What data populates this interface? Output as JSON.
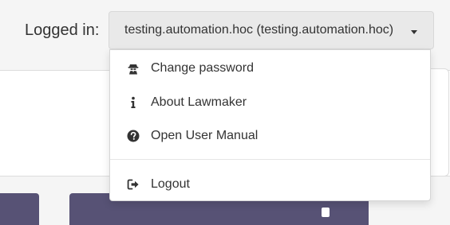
{
  "header": {
    "login_label": "Logged in:",
    "user_display": "testing.automation.hoc (testing.automation.hoc)"
  },
  "user_menu": {
    "items": [
      {
        "label": "Change password",
        "icon": "user-secret-icon"
      },
      {
        "label": "About Lawmaker",
        "icon": "info-icon"
      },
      {
        "label": "Open User Manual",
        "icon": "question-circle-icon"
      },
      {
        "label": "Logout",
        "icon": "sign-out-icon"
      }
    ]
  },
  "colors": {
    "page_background": "#f5f5f5",
    "toggle_background": "#e9e9e9",
    "tile_purple": "#575275",
    "text": "#333333"
  }
}
